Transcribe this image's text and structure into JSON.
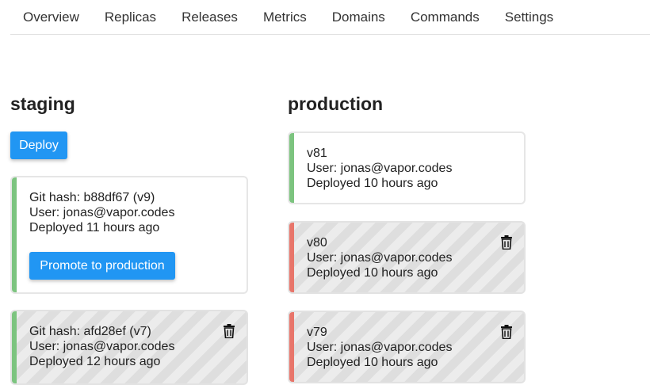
{
  "tabs": [
    "Overview",
    "Replicas",
    "Releases",
    "Metrics",
    "Domains",
    "Commands",
    "Settings"
  ],
  "staging": {
    "title": "staging",
    "deploy_label": "Deploy",
    "cards": [
      {
        "status": "active",
        "line1": "Git hash: b88df67 (v9)",
        "line2": "User: jonas@vapor.codes",
        "line3": "Deployed 11 hours ago",
        "promote_label": "Promote to production"
      },
      {
        "status": "inactive",
        "line1": "Git hash: afd28ef (v7)",
        "line2": "User: jonas@vapor.codes",
        "line3": "Deployed 12 hours ago",
        "icon": "trash-icon"
      }
    ]
  },
  "production": {
    "title": "production",
    "cards": [
      {
        "status": "active",
        "line1": "v81",
        "line2": "User: jonas@vapor.codes",
        "line3": "Deployed 10 hours ago"
      },
      {
        "status": "failed",
        "line1": "v80",
        "line2": "User: jonas@vapor.codes",
        "line3": "Deployed 10 hours ago",
        "icon": "trash-icon"
      },
      {
        "status": "failed",
        "line1": "v79",
        "line2": "User: jonas@vapor.codes",
        "line3": "Deployed 10 hours ago",
        "icon": "trash-icon"
      }
    ]
  },
  "colors": {
    "accent": "#2196f3",
    "success": "#7cc47f",
    "error": "#e8756a"
  }
}
